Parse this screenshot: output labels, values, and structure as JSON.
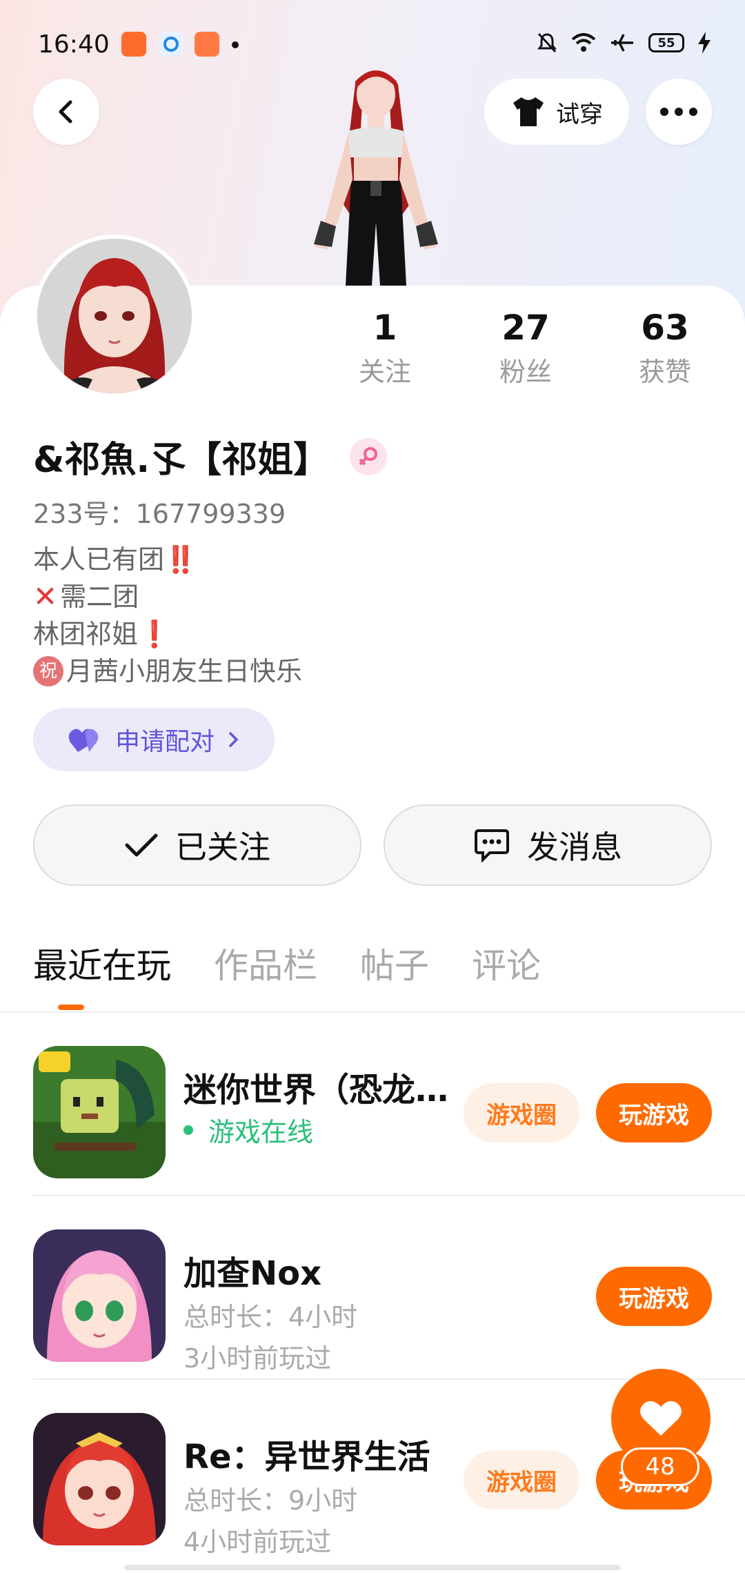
{
  "status_bar": {
    "time": "16:40",
    "battery": "55",
    "icons": [
      "mute-icon",
      "wifi-icon",
      "airplane-icon",
      "battery-icon",
      "charging-icon"
    ]
  },
  "header": {
    "try_on_label": "试穿"
  },
  "profile": {
    "stats": [
      {
        "value": "1",
        "label": "关注"
      },
      {
        "value": "27",
        "label": "粉丝"
      },
      {
        "value": "63",
        "label": "获赞"
      }
    ],
    "username": "&祁魚.孓【祁姐】",
    "uid": "233号：167799339",
    "bio": {
      "line1": "本人已有团",
      "line1_emoji": "‼️",
      "line2_emoji": "✕",
      "line2": "需二团",
      "line3": "林团祁姐",
      "line3_emoji": "❗",
      "line4_emoji": "祝",
      "line4": "月茜小朋友生日快乐"
    },
    "pair_label": "申请配对"
  },
  "actions": {
    "followed_label": "已关注",
    "message_label": "发消息"
  },
  "tabs": [
    "最近在玩",
    "作品栏",
    "帖子",
    "评论"
  ],
  "games": [
    {
      "title": "迷你世界（恐龙…",
      "status": "游戏在线",
      "circle_label": "游戏圈",
      "play_label": "玩游戏"
    },
    {
      "title": "加查Nox",
      "duration": "总时长：4小时",
      "last_played": "3小时前玩过",
      "play_label": "玩游戏"
    },
    {
      "title": "Re：异世界生活",
      "duration": "总时长：9小时",
      "last_played": "4小时前玩过",
      "circle_label": "游戏圈",
      "play_label": "玩游戏"
    }
  ],
  "like_fab": {
    "count": "48"
  },
  "colors": {
    "accent": "#ff6a00",
    "accent_light": "#fff0e6",
    "online": "#2bbf7a",
    "pair_bg": "#ece9fb",
    "pair_text": "#5e56d6"
  }
}
